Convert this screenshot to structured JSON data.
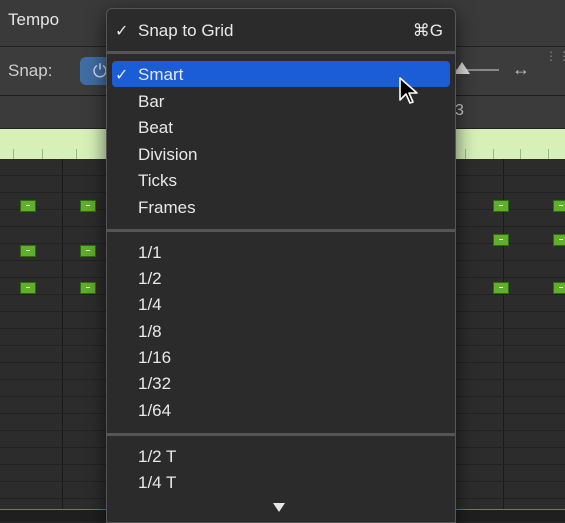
{
  "toolbar": {
    "tempo_label": "Tempo"
  },
  "snap_bar": {
    "snap_label": "Snap:",
    "power_icon": "power-icon",
    "resize_icon": "horizontal-resize-icon"
  },
  "ruler": {
    "bar_number": "3"
  },
  "menu": {
    "header": {
      "checkmark": "✓",
      "label": "Snap to Grid",
      "shortcut": "⌘G"
    },
    "modes": [
      {
        "checkmark": "✓",
        "label": "Smart",
        "selected": true
      },
      {
        "checkmark": "",
        "label": "Bar"
      },
      {
        "checkmark": "",
        "label": "Beat"
      },
      {
        "checkmark": "",
        "label": "Division"
      },
      {
        "checkmark": "",
        "label": "Ticks"
      },
      {
        "checkmark": "",
        "label": "Frames"
      }
    ],
    "values": [
      {
        "label": "1/1"
      },
      {
        "label": "1/2"
      },
      {
        "label": "1/4"
      },
      {
        "label": "1/8"
      },
      {
        "label": "1/16"
      },
      {
        "label": "1/32"
      },
      {
        "label": "1/64"
      }
    ],
    "triplets": [
      {
        "label": "1/2 T"
      },
      {
        "label": "1/4 T"
      }
    ],
    "scroll_icon": "scroll-down-arrow-icon"
  },
  "colors": {
    "selection": "#1a5dd6",
    "note_fill": "#5fae2c",
    "ruler_strip": "#d6f0b8"
  }
}
